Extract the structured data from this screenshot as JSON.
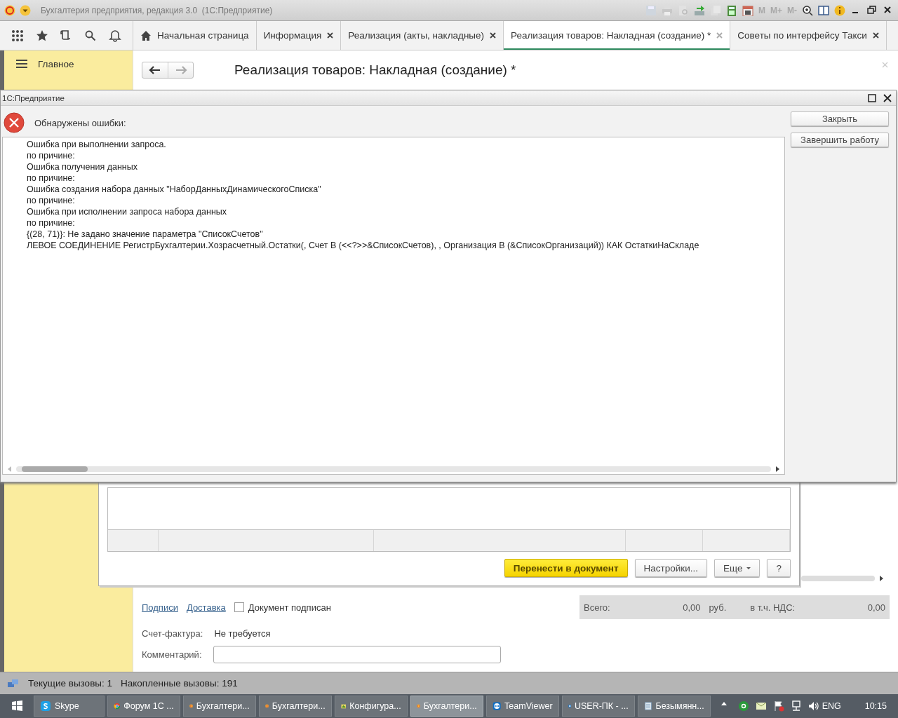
{
  "window": {
    "title": "Бухгалтерия предприятия, редакция 3.0  (1С:Предприятие)"
  },
  "memory_buttons": [
    {
      "label": "M",
      "disabled": true
    },
    {
      "label": "M+",
      "disabled": true
    },
    {
      "label": "M-",
      "disabled": true
    }
  ],
  "tabs": [
    {
      "label": "Начальная страница",
      "kind": "home",
      "closable": false,
      "selected": false
    },
    {
      "label": "Информация",
      "kind": "page",
      "closable": true,
      "selected": false
    },
    {
      "label": "Реализация (акты, накладные)",
      "kind": "page",
      "closable": true,
      "selected": false
    },
    {
      "label": "Реализация товаров: Накладная (создание) *",
      "kind": "page",
      "closable": true,
      "selected": true
    },
    {
      "label": "Советы по интерфейсу Такси",
      "kind": "page",
      "closable": true,
      "selected": false
    }
  ],
  "sidebar": {
    "items": [
      {
        "label": "Главное",
        "kind": "menu"
      }
    ]
  },
  "document": {
    "title": "Реализация товаров: Накладная (создание) *",
    "links": [
      "Подписи",
      "Доставка"
    ],
    "signed": {
      "label": "Документ подписан",
      "checked": false
    },
    "invoice": {
      "label": "Счет-фактура:",
      "value": "Не требуется"
    },
    "comment": {
      "label": "Комментарий:"
    },
    "totals": {
      "total_label": "Всего:",
      "total": "0,00",
      "currency": "руб.",
      "vat_label": "в т.ч. НДС:",
      "vat": "0,00"
    }
  },
  "selection_form": {
    "buttons": [
      {
        "label": "Перенести в документ",
        "kind": "primary"
      },
      {
        "label": "Настройки...",
        "kind": "normal"
      },
      {
        "label": "Еще",
        "kind": "menu"
      },
      {
        "label": "?",
        "kind": "normal"
      }
    ]
  },
  "dialog": {
    "title": "1С:Предприятие",
    "heading": "Обнаружены ошибки:",
    "message_lines": [
      "Ошибка при выполнении запроса.",
      "по причине:",
      "Ошибка получения данных",
      "по причине:",
      "Ошибка создания набора данных \"НаборДанныхДинамическогоСписка\"",
      "по причине:",
      "Ошибка при исполнении запроса набора данных",
      "по причине:",
      "{(28, 71)}: Не задано значение параметра \"СписокСчетов\"",
      "ЛЕВОЕ СОЕДИНЕНИЕ РегистрБухгалтерии.Хозрасчетный.Остатки(, Счет В (<<?>>&СписокСчетов), , Организация В (&СписокОрганизаций)) КАК ОстаткиНаСкладе"
    ],
    "buttons": [
      "Закрыть",
      "Завершить работу"
    ]
  },
  "status_bar": {
    "current": "Текущие вызовы: 1",
    "accumulated": "Накопленные вызовы: 191"
  },
  "taskbar": {
    "items": [
      {
        "label": "Skype",
        "kind": "skype",
        "selected": false
      },
      {
        "label": "Форум 1С ...",
        "kind": "browser",
        "selected": false
      },
      {
        "label": "Бухгалтери...",
        "kind": "onec",
        "selected": false
      },
      {
        "label": "Бухгалтери...",
        "kind": "onec",
        "selected": false
      },
      {
        "label": "Конфигура...",
        "kind": "config",
        "selected": false
      },
      {
        "label": "Бухгалтери...",
        "kind": "onec",
        "selected": true
      },
      {
        "label": "TeamViewer",
        "kind": "teamviewer",
        "selected": false
      },
      {
        "label": "USER-ПК - ...",
        "kind": "teamviewer",
        "selected": false
      },
      {
        "label": "Безымянн...",
        "kind": "notepad",
        "selected": false
      }
    ],
    "language": "ENG",
    "time": "10:15"
  }
}
